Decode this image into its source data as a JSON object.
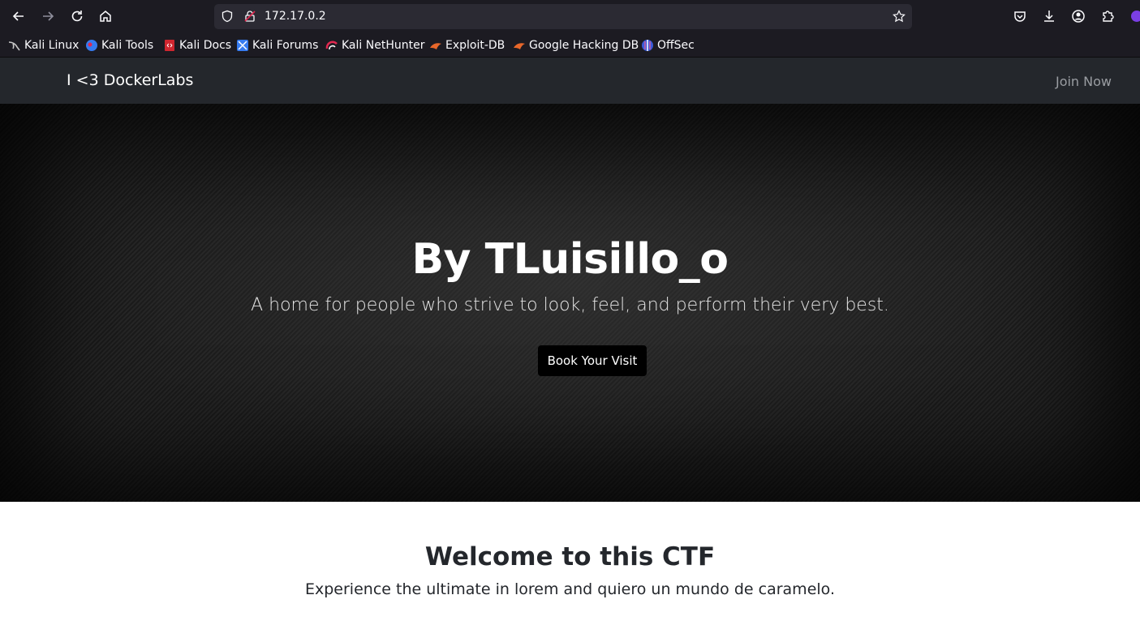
{
  "browser": {
    "url": "172.17.0.2",
    "bookmarks": [
      {
        "label": "Kali Linux",
        "icon": "kali-dragon-icon"
      },
      {
        "label": "Kali Tools",
        "icon": "kali-tools-icon"
      },
      {
        "label": "Kali Docs",
        "icon": "kali-docs-icon"
      },
      {
        "label": "Kali Forums",
        "icon": "kali-forums-icon"
      },
      {
        "label": "Kali NetHunter",
        "icon": "kali-nethunter-icon"
      },
      {
        "label": "Exploit-DB",
        "icon": "exploit-db-icon"
      },
      {
        "label": "Google Hacking DB",
        "icon": "ghdb-icon"
      },
      {
        "label": "OffSec",
        "icon": "offsec-icon"
      }
    ]
  },
  "navbar": {
    "brand": "I <3 DockerLabs",
    "join_label": "Join Now"
  },
  "hero": {
    "title": "By TLuisillo_o",
    "subtitle": "A home for people who strive to look, feel, and perform their very best.",
    "button_label": "Book Your Visit"
  },
  "welcome": {
    "title": "Welcome to this CTF",
    "text": "Experience the ultimate in lorem and quiero un mundo de caramelo."
  },
  "colors": {
    "chrome_bg": "#1c1b22",
    "urlbar_bg": "#2b2a33",
    "navbar_bg": "#24272c",
    "hero_button_bg": "#000000",
    "text_dark": "#24272c"
  }
}
